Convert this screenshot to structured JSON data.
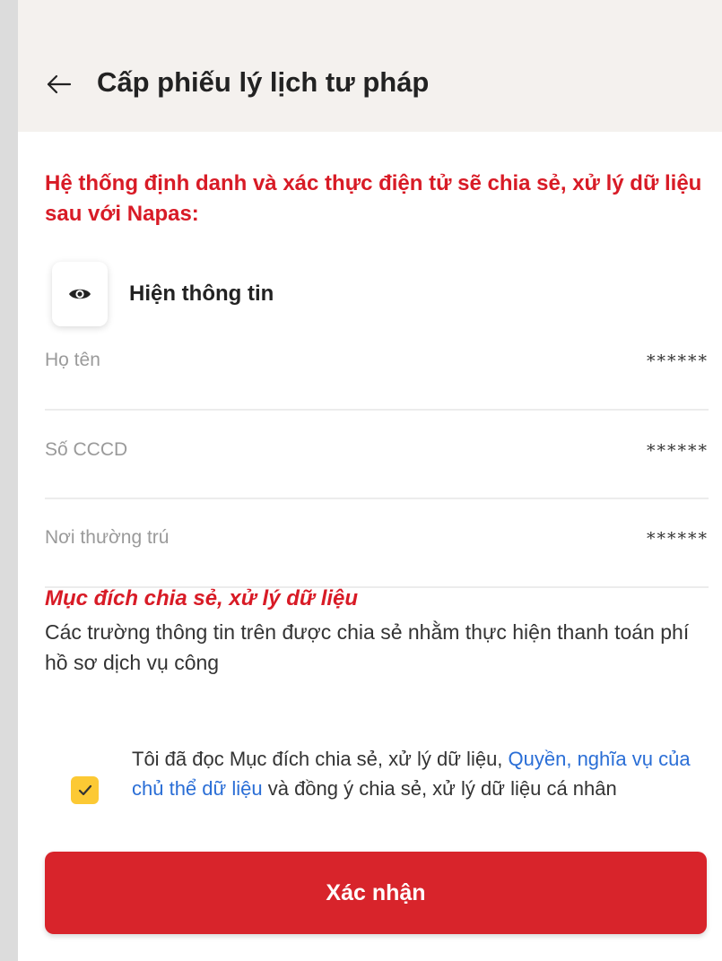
{
  "header": {
    "title": "Cấp phiếu lý lịch tư pháp",
    "back_icon": "arrow-left-icon"
  },
  "notice": "Hệ thống định danh và xác thực điện tử sẽ chia sẻ, xử lý dữ liệu sau với Napas:",
  "reveal": {
    "icon": "eye-icon",
    "label": "Hiện thông tin"
  },
  "fields": [
    {
      "label": "Họ tên",
      "value": "******"
    },
    {
      "label": "Số CCCD",
      "value": "******"
    },
    {
      "label": "Nơi thường trú",
      "value": "******"
    }
  ],
  "purpose": {
    "title": "Mục đích chia sẻ, xử lý dữ liệu",
    "body": "Các trường thông tin trên được chia sẻ nhằm thực hiện thanh toán phí hồ sơ dịch vụ công"
  },
  "consent": {
    "checked": true,
    "text_before": "Tôi đã đọc Mục đích chia sẻ, xử lý dữ liệu, ",
    "link": "Quyền, nghĩa vụ của chủ thể dữ liệu",
    "text_after": " và đồng ý chia sẻ, xử lý dữ liệu cá nhân"
  },
  "confirm_button": "Xác nhận",
  "colors": {
    "accent_red": "#d81b26",
    "button_red": "#d8242b",
    "link_blue": "#2a6ed6",
    "checkbox_yellow": "#fcc934",
    "header_bg": "#f4f1ee"
  }
}
